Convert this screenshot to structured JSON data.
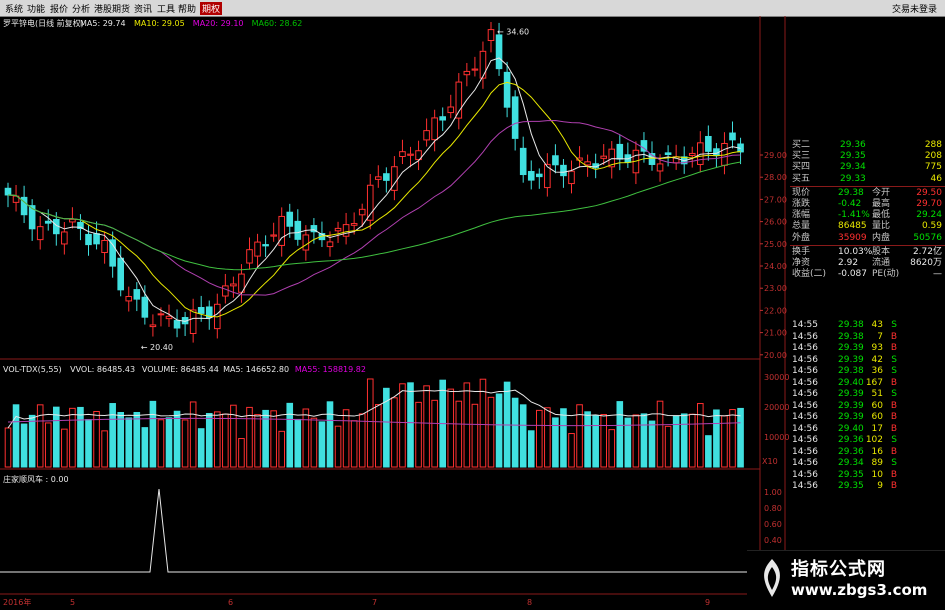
{
  "menubar": {
    "items": [
      "系统",
      "功能",
      "报价",
      "分析",
      "港股期货",
      "资讯",
      "工具",
      "帮助",
      "期权"
    ],
    "active_index": 8,
    "login": "交易未登录"
  },
  "kline": {
    "header": "罗平锌电(日线 前复权)",
    "ma_labels": [
      {
        "text": "MA5: 29.74",
        "color": "#e8e8e8"
      },
      {
        "text": "MA10: 29.05",
        "color": "#e8e800"
      },
      {
        "text": "MA20: 29.10",
        "color": "#e000e0"
      },
      {
        "text": "MA60: 28.62",
        "color": "#00c000"
      }
    ],
    "y_ticks": [
      "29.00",
      "28.00",
      "27.00",
      "26.00",
      "25.00",
      "24.00",
      "23.00",
      "22.00",
      "21.00",
      "20.00"
    ],
    "high_label": "34.60",
    "low_label": "20.40"
  },
  "volume": {
    "header": [
      {
        "text": "VOL-TDX(5,55)",
        "color": "#e8e8e8"
      },
      {
        "text": "VVOL: 86485.43",
        "color": "#e8e8e8"
      },
      {
        "text": "VOLUME: 86485.44",
        "color": "#e8e8e8"
      },
      {
        "text": "MA5: 146652.80",
        "color": "#e8e8e8"
      },
      {
        "text": "MA55: 158819.82",
        "color": "#e000e0"
      }
    ],
    "y_ticks": [
      "30000",
      "20000",
      "10000"
    ],
    "unit": "X10"
  },
  "indicator": {
    "header": "庄家顺风车 : 0.00",
    "y_ticks": [
      "1.00",
      "0.80",
      "0.60",
      "0.40",
      "0.20",
      "0.00"
    ]
  },
  "x_axis": {
    "labels": [
      "2016年",
      "5",
      "6",
      "7",
      "8",
      "9"
    ]
  },
  "quote": {
    "rows": [
      {
        "label": "买二",
        "value": "29.36",
        "vol": "288",
        "vcolor": "#00e000"
      },
      {
        "label": "买三",
        "value": "29.35",
        "vol": "208",
        "vcolor": "#00e000"
      },
      {
        "label": "买四",
        "value": "29.34",
        "vol": "775",
        "vcolor": "#00e000"
      },
      {
        "label": "买五",
        "value": "29.33",
        "vol": "46",
        "vcolor": "#00e000"
      },
      {
        "label": "现价",
        "value": "29.38",
        "label2": "今开",
        "value2": "29.50",
        "vcolor": "#00e000",
        "v2color": "#ff3030"
      },
      {
        "label": "涨跌",
        "value": "-0.42",
        "label2": "最高",
        "value2": "29.70",
        "vcolor": "#00e000",
        "v2color": "#ff3030"
      },
      {
        "label": "涨幅",
        "value": "-1.41%",
        "label2": "最低",
        "value2": "29.24",
        "vcolor": "#00e000",
        "v2color": "#00e000"
      },
      {
        "label": "总量",
        "value": "86485",
        "label2": "量比",
        "value2": "0.59",
        "vcolor": "#e8e800",
        "v2color": "#e8e800"
      },
      {
        "label": "外盘",
        "value": "35909",
        "label2": "内盘",
        "value2": "50576",
        "vcolor": "#ff3030",
        "v2color": "#00e000"
      },
      {
        "label": "换手",
        "value": "10.03%",
        "label2": "股本",
        "value2": "2.72亿",
        "vcolor": "#e8e8e8",
        "v2color": "#e8e8e8"
      },
      {
        "label": "净资",
        "value": "2.92",
        "label2": "流通",
        "value2": "8620万",
        "vcolor": "#e8e8e8",
        "v2color": "#e8e8e8"
      },
      {
        "label": "收益(二)",
        "value": "-0.087",
        "label2": "PE(动)",
        "value2": "—",
        "vcolor": "#e8e8e8",
        "v2color": "#e8e8e8"
      }
    ]
  },
  "ticks": {
    "rows": [
      {
        "time": "14:55",
        "price": "29.38",
        "vol": "43",
        "side": "S"
      },
      {
        "time": "14:56",
        "price": "29.38",
        "vol": "7",
        "side": "B"
      },
      {
        "time": "14:56",
        "price": "29.39",
        "vol": "93",
        "side": "B"
      },
      {
        "time": "14:56",
        "price": "29.39",
        "vol": "42",
        "side": "S"
      },
      {
        "time": "14:56",
        "price": "29.38",
        "vol": "36",
        "side": "S"
      },
      {
        "time": "14:56",
        "price": "29.40",
        "vol": "167",
        "side": "B"
      },
      {
        "time": "14:56",
        "price": "29.39",
        "vol": "51",
        "side": "S"
      },
      {
        "time": "14:56",
        "price": "29.39",
        "vol": "60",
        "side": "B"
      },
      {
        "time": "14:56",
        "price": "29.39",
        "vol": "60",
        "side": "B"
      },
      {
        "time": "14:56",
        "price": "29.40",
        "vol": "17",
        "side": "B"
      },
      {
        "time": "14:56",
        "price": "29.36",
        "vol": "102",
        "side": "S"
      },
      {
        "time": "14:56",
        "price": "29.36",
        "vol": "16",
        "side": "B"
      },
      {
        "time": "14:56",
        "price": "29.34",
        "vol": "89",
        "side": "S"
      },
      {
        "time": "14:56",
        "price": "29.35",
        "vol": "10",
        "side": "B"
      },
      {
        "time": "14:56",
        "price": "29.35",
        "vol": "9",
        "side": "B"
      }
    ]
  },
  "watermark": {
    "title": "指标公式网",
    "url": "www.zbgs3.com"
  },
  "colors": {
    "up": "#ff3030",
    "down": "#40e0e0",
    "ma5": "#e8e8e8",
    "ma10": "#e8e800",
    "ma20": "#b040b0",
    "ma60": "#40c040",
    "grid": "#8a1a1a"
  }
}
